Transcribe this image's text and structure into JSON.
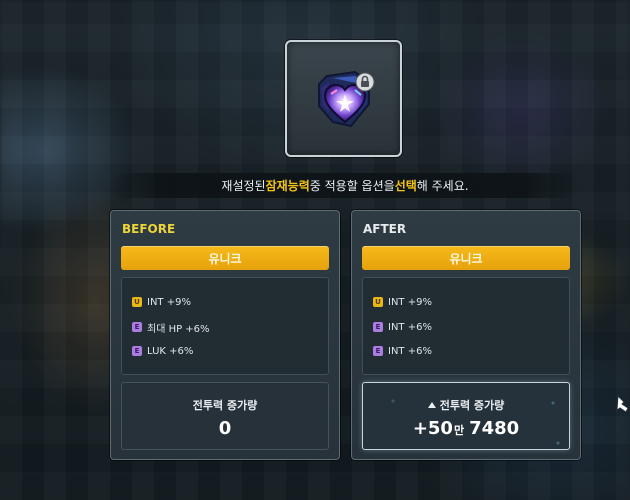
{
  "banner": {
    "part1": "재설정된 ",
    "highlight1": "잠재능력",
    "part2": " 중 적용할 옵션을 ",
    "highlight2": "선택",
    "part3": "해 주세요."
  },
  "item": {
    "icon": "heart-shield-icon",
    "lock_icon": "lock-icon"
  },
  "before": {
    "title": "BEFORE",
    "grade": "유니크",
    "options": [
      {
        "badge": "U",
        "text": "INT +9%"
      },
      {
        "badge": "E",
        "text": "최대 HP +6%"
      },
      {
        "badge": "E",
        "text": "LUK +6%"
      }
    ],
    "power_label": "전투력 증가량",
    "power_value": "0"
  },
  "after": {
    "title": "AFTER",
    "grade": "유니크",
    "options": [
      {
        "badge": "U",
        "text": "INT +9%"
      },
      {
        "badge": "E",
        "text": "INT +6%"
      },
      {
        "badge": "E",
        "text": "INT +6%"
      }
    ],
    "power_label": "전투력 증가량",
    "power_value_main": "+50",
    "power_value_unit": "만",
    "power_value_rest": "7480"
  },
  "colors": {
    "grade_bar": "#f0ad12",
    "highlight": "#f2c318",
    "badge_u": "#e8b817",
    "badge_e": "#a97ee0"
  }
}
